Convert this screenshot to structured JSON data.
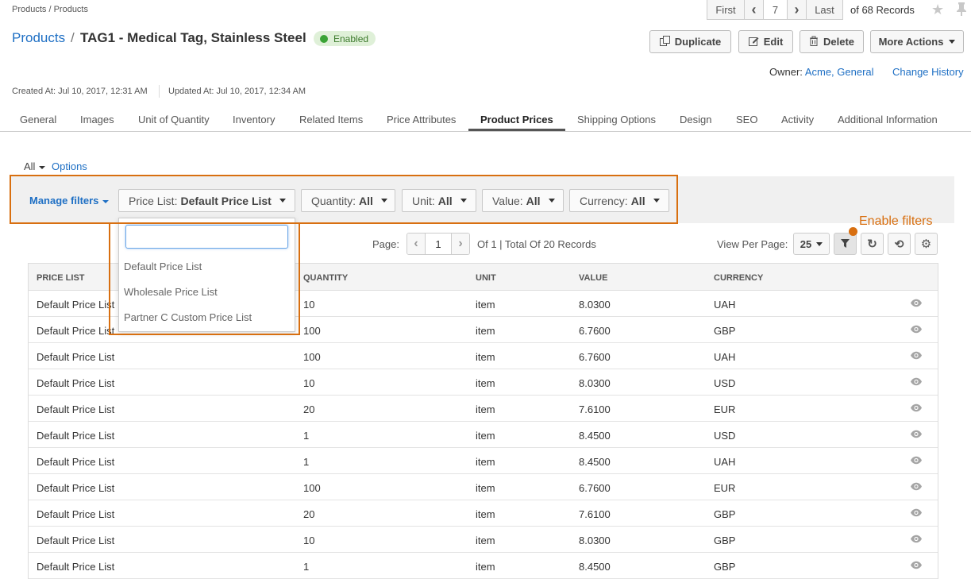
{
  "breadcrumb": "Products / Products",
  "pager": {
    "first": "First",
    "prev": "‹",
    "page": "7",
    "next": "›",
    "last": "Last",
    "records": "of 68 Records"
  },
  "title": {
    "link": "Products",
    "separator": "/",
    "text": "TAG1 - Medical Tag, Stainless Steel",
    "status": "Enabled"
  },
  "actions": {
    "duplicate": "Duplicate",
    "edit": "Edit",
    "delete": "Delete",
    "more": "More Actions"
  },
  "owner": {
    "label": "Owner:",
    "value": "Acme, General",
    "history": "Change History"
  },
  "meta": {
    "created": "Created At: Jul 10, 2017, 12:31 AM",
    "updated": "Updated At: Jul 10, 2017, 12:34 AM"
  },
  "tabs": [
    "General",
    "Images",
    "Unit of Quantity",
    "Inventory",
    "Related Items",
    "Price Attributes",
    "Product Prices",
    "Shipping Options",
    "Design",
    "SEO",
    "Activity",
    "Additional Information"
  ],
  "active_tab": "Product Prices",
  "filters": {
    "all": "All",
    "options": "Options",
    "manage": "Manage filters",
    "price_list": {
      "label": "Price List:",
      "value": "Default Price List"
    },
    "quantity": {
      "label": "Quantity:",
      "value": "All"
    },
    "unit": {
      "label": "Unit:",
      "value": "All"
    },
    "value": {
      "label": "Value:",
      "value": "All"
    },
    "currency": {
      "label": "Currency:",
      "value": "All"
    },
    "dropdown_search": "",
    "dropdown_items": [
      "Default Price List",
      "Wholesale Price List",
      "Partner C Custom Price List"
    ]
  },
  "annotation": {
    "note": "Enable filters",
    "color": "#d86f10"
  },
  "pagination": {
    "label": "Page:",
    "page": "1",
    "info": "Of 1 | Total Of 20 Records",
    "per_page_label": "View Per Page:",
    "per_page": "25"
  },
  "grid": {
    "headers": [
      "PRICE LIST",
      "QUANTITY",
      "UNIT",
      "VALUE",
      "CURRENCY"
    ],
    "rows": [
      [
        "Default Price List",
        "10",
        "item",
        "8.0300",
        "UAH"
      ],
      [
        "Default Price List",
        "100",
        "item",
        "6.7600",
        "GBP"
      ],
      [
        "Default Price List",
        "100",
        "item",
        "6.7600",
        "UAH"
      ],
      [
        "Default Price List",
        "10",
        "item",
        "8.0300",
        "USD"
      ],
      [
        "Default Price List",
        "20",
        "item",
        "7.6100",
        "EUR"
      ],
      [
        "Default Price List",
        "1",
        "item",
        "8.4500",
        "USD"
      ],
      [
        "Default Price List",
        "1",
        "item",
        "8.4500",
        "UAH"
      ],
      [
        "Default Price List",
        "100",
        "item",
        "6.7600",
        "EUR"
      ],
      [
        "Default Price List",
        "20",
        "item",
        "7.6100",
        "GBP"
      ],
      [
        "Default Price List",
        "10",
        "item",
        "8.0300",
        "GBP"
      ],
      [
        "Default Price List",
        "1",
        "item",
        "8.4500",
        "GBP"
      ]
    ]
  },
  "colors": {
    "link": "#1e6fc4",
    "status_bg": "#dff0d8",
    "status_dot": "#3aa335",
    "highlight": "#d86f10"
  }
}
